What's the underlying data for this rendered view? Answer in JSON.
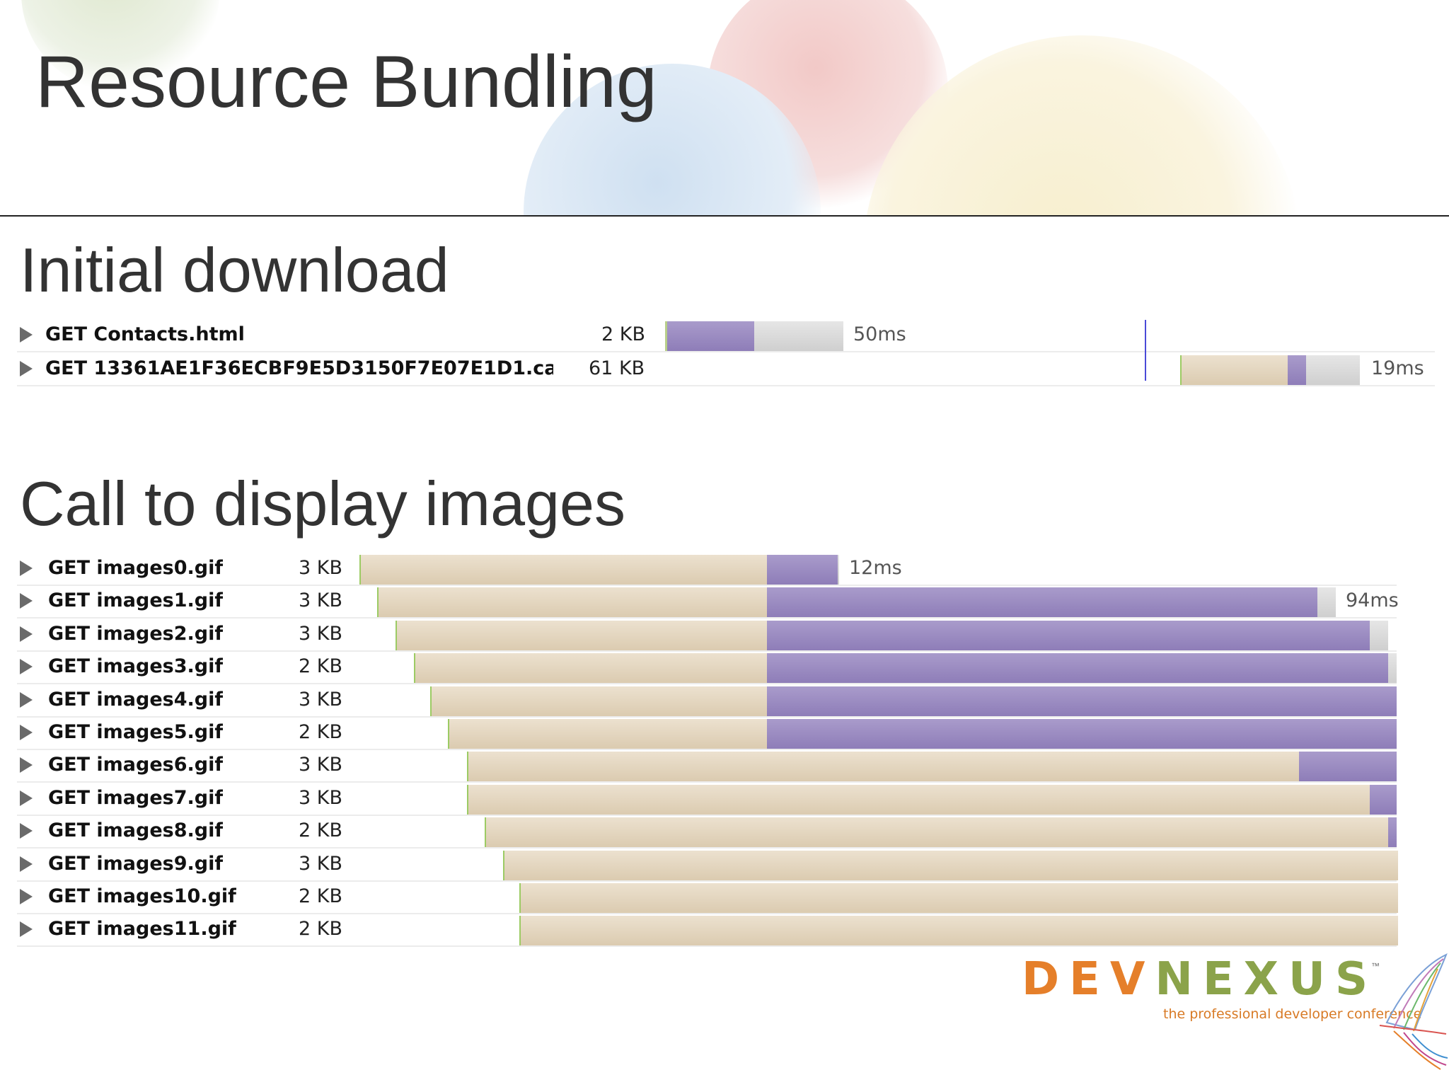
{
  "slide": {
    "title": "Resource Bundling"
  },
  "initial": {
    "heading": "Initial download",
    "rows": [
      {
        "label": "GET Contacts.html",
        "size": "2 KB",
        "time": "50ms"
      },
      {
        "label": "GET 13361AE1F36ECBF9E5D3150F7E07E1D1.ca",
        "size": "61 KB",
        "time": "19ms"
      }
    ]
  },
  "images": {
    "heading": "Call to display images",
    "rows": [
      {
        "label": "GET images0.gif",
        "size": "3 KB",
        "time": "12ms"
      },
      {
        "label": "GET images1.gif",
        "size": "3 KB",
        "time": "94ms"
      },
      {
        "label": "GET images2.gif",
        "size": "3 KB",
        "time": ""
      },
      {
        "label": "GET images3.gif",
        "size": "2 KB",
        "time": ""
      },
      {
        "label": "GET images4.gif",
        "size": "3 KB",
        "time": ""
      },
      {
        "label": "GET images5.gif",
        "size": "2 KB",
        "time": ""
      },
      {
        "label": "GET images6.gif",
        "size": "3 KB",
        "time": ""
      },
      {
        "label": "GET images7.gif",
        "size": "3 KB",
        "time": ""
      },
      {
        "label": "GET images8.gif",
        "size": "2 KB",
        "time": ""
      },
      {
        "label": "GET images9.gif",
        "size": "3 KB",
        "time": ""
      },
      {
        "label": "GET images10.gif",
        "size": "2 KB",
        "time": ""
      },
      {
        "label": "GET images11.gif",
        "size": "2 KB",
        "time": ""
      }
    ]
  },
  "logo": {
    "word_dev": "DEV",
    "word_nexus": "NEXUS",
    "tm": "™",
    "tagline": "the professional developer conference"
  },
  "colors": {
    "waiting": "#dccdb2",
    "receiving": "#9385bd",
    "idle": "#d6d6d6",
    "brand_orange": "#e57f2a",
    "brand_green": "#8ba34a"
  }
}
